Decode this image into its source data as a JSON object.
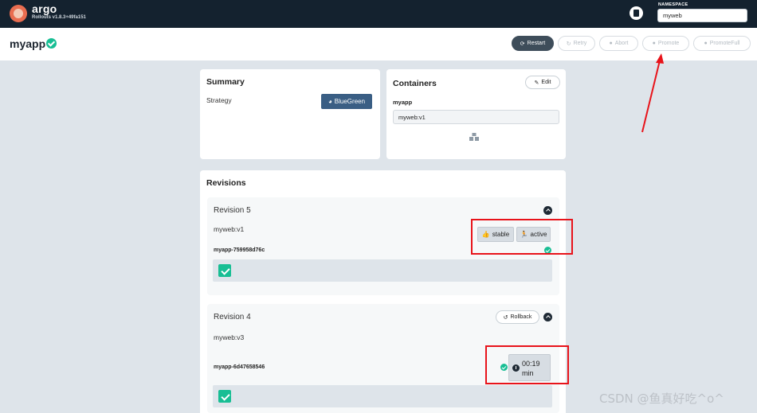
{
  "topbar": {
    "brand": "argo",
    "version": "Rollouts v1.8.3+49fa151",
    "namespace_label": "NAMESPACE",
    "namespace_value": "myweb"
  },
  "header": {
    "app_name": "myapp",
    "buttons": {
      "restart": "Restart",
      "retry": "Retry",
      "abort": "Abort",
      "promote": "Promote",
      "promote_full": "PromoteFull"
    }
  },
  "summary": {
    "title": "Summary",
    "strategy_label": "Strategy",
    "strategy_value": "BlueGreen"
  },
  "containers": {
    "title": "Containers",
    "edit_label": "Edit",
    "name": "myapp",
    "image": "myweb:v1"
  },
  "revisions": {
    "title": "Revisions",
    "items": [
      {
        "title": "Revision 5",
        "image": "myweb:v1",
        "replicaset": "myapp-759958d76c",
        "tags": [
          "stable",
          "active"
        ]
      },
      {
        "title": "Revision 4",
        "image": "myweb:v3",
        "replicaset": "myapp-6d47658546",
        "rollback_label": "Rollback",
        "timer": "00:19 min"
      }
    ]
  },
  "watermark": "CSDN @鱼真好吃^o^",
  "colors": {
    "topbar": "#14222f",
    "accent_green": "#18be94",
    "strategy_badge": "#3a5e84",
    "annotation_red": "#e8131a"
  }
}
